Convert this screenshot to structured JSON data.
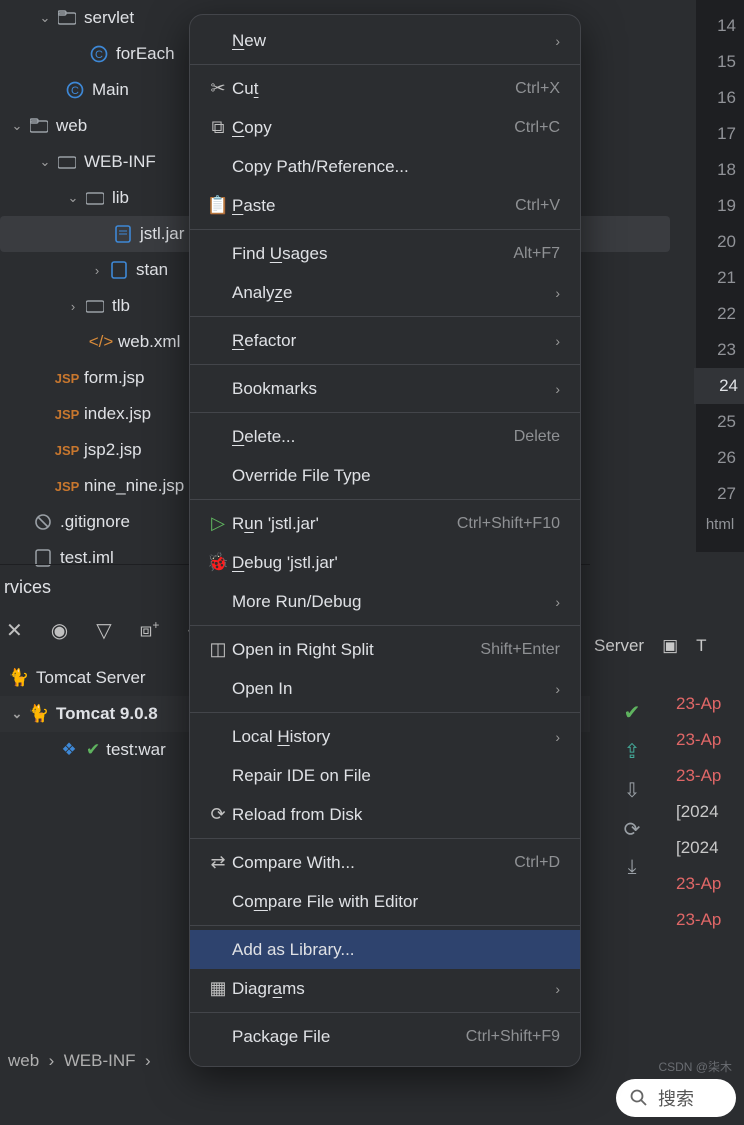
{
  "tree": {
    "servlet_folder": "servlet",
    "forEach": "forEach",
    "main": "Main",
    "web": "web",
    "webinf": "WEB-INF",
    "lib": "lib",
    "jstl": "jstl.jar",
    "stan": "stan",
    "tlb": "tlb",
    "webxml": "web.xml",
    "form": "form.jsp",
    "index": "index.jsp",
    "jsp2": "jsp2.jsp",
    "nine": "nine_nine.jsp",
    "gitignore": ".gitignore",
    "testiml": "test.iml"
  },
  "services": {
    "title": "rvices",
    "tomcat_server": "Tomcat Server",
    "tomcat9": "Tomcat 9.0.8",
    "war": "test:war"
  },
  "breadcrumb": {
    "a": "web",
    "b": "WEB-INF"
  },
  "gutter": {
    "lines": [
      "14",
      "15",
      "16",
      "17",
      "18",
      "19",
      "20",
      "21",
      "22",
      "23",
      "24",
      "25",
      "26",
      "27"
    ],
    "current": "24",
    "tag": "html"
  },
  "server_tab": {
    "server": "Server",
    "t": "T"
  },
  "logs": {
    "l1": "23-Ap",
    "l2": "23-Ap",
    "l3": "23-Ap",
    "l4": "[2024",
    "l5": "[2024",
    "l6": "23-Ap",
    "l7": "23-Ap"
  },
  "menu": {
    "new": "New",
    "cut": "Cut",
    "cut_sc": "Ctrl+X",
    "copy": "Copy",
    "copy_sc": "Ctrl+C",
    "copy_path": "Copy Path/Reference...",
    "paste": "Paste",
    "paste_sc": "Ctrl+V",
    "find_usages": "Find Usages",
    "find_usages_sc": "Alt+F7",
    "analyze": "Analyze",
    "refactor": "Refactor",
    "bookmarks": "Bookmarks",
    "delete": "Delete...",
    "delete_sc": "Delete",
    "override": "Override File Type",
    "run": "Run 'jstl.jar'",
    "run_sc": "Ctrl+Shift+F10",
    "debug": "Debug 'jstl.jar'",
    "more_run": "More Run/Debug",
    "open_split": "Open in Right Split",
    "open_split_sc": "Shift+Enter",
    "open_in": "Open In",
    "local_history": "Local History",
    "repair": "Repair IDE on File",
    "reload": "Reload from Disk",
    "compare_with": "Compare With...",
    "compare_with_sc": "Ctrl+D",
    "compare_editor": "Compare File with Editor",
    "add_library": "Add as Library...",
    "diagrams": "Diagrams",
    "package_file": "Package File",
    "package_file_sc": "Ctrl+Shift+F9"
  },
  "icon_glyphs": {
    "chev_down": "⌄",
    "chev_right": "›",
    "scissors": "✂",
    "copy": "⧉",
    "paste": "📋",
    "run": "▷",
    "debug": "🐞",
    "split": "◫",
    "reload": "⟳",
    "compare": "⇄",
    "diagram": "▦"
  },
  "search": {
    "placeholder": "搜索"
  },
  "watermark": "CSDN @柒木"
}
